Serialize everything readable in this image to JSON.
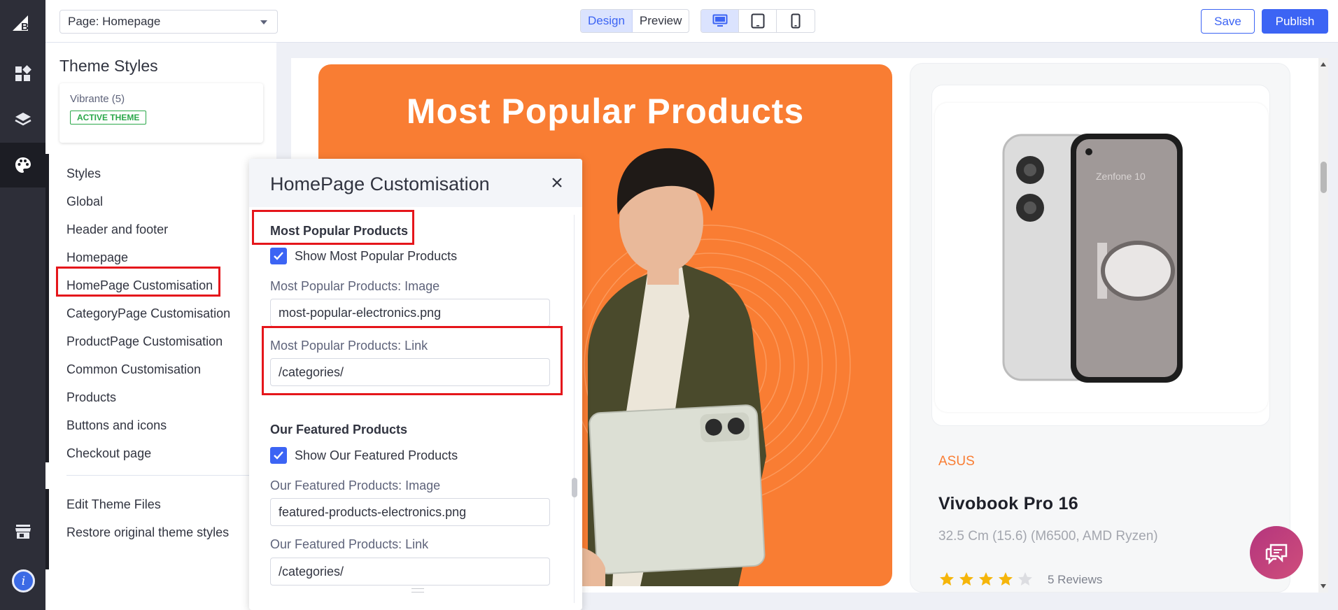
{
  "topbar": {
    "page_select": "Page: Homepage",
    "modes": [
      "Design",
      "Preview"
    ],
    "save_label": "Save",
    "publish_label": "Publish"
  },
  "sidebar": {
    "title": "Theme Styles",
    "theme_name": "Vibrante (5)",
    "theme_badge": "ACTIVE THEME",
    "items": [
      {
        "label": "Styles"
      },
      {
        "label": "Global"
      },
      {
        "label": "Header and footer"
      },
      {
        "label": "Homepage"
      },
      {
        "label": "HomePage Customisation"
      },
      {
        "label": "CategoryPage Customisation"
      },
      {
        "label": "ProductPage Customisation"
      },
      {
        "label": "Common Customisation"
      },
      {
        "label": "Products"
      },
      {
        "label": "Buttons and icons"
      },
      {
        "label": "Checkout page"
      }
    ],
    "footer_items": [
      {
        "label": "Edit Theme Files"
      },
      {
        "label": "Restore original theme styles"
      }
    ]
  },
  "modal": {
    "title": "HomePage Customisation",
    "sections": [
      {
        "title": "Most Popular Products",
        "checkbox_label": "Show Most Popular Products",
        "image_label": "Most Popular Products: Image",
        "image_value": "most-popular-electronics.png",
        "link_label": "Most Popular Products: Link",
        "link_value": "/categories/"
      },
      {
        "title": "Our Featured Products",
        "checkbox_label": "Show Our Featured Products",
        "image_label": "Our Featured Products: Image",
        "image_value": "featured-products-electronics.png",
        "link_label": "Our Featured Products: Link",
        "link_value": "/categories/"
      }
    ]
  },
  "preview": {
    "hero_title": "Most Popular Products",
    "product": {
      "brand": "ASUS",
      "name": "Vivobook Pro 16",
      "description": "32.5 Cm (15.6) (M6500, AMD Ryzen)",
      "rating_stars": 4,
      "rating_max": 5,
      "reviews": "5 Reviews"
    }
  },
  "colors": {
    "accent": "#3c64f4",
    "hero_orange": "#f97d33",
    "highlight_red": "#e5161b",
    "rail": "#2d2e38"
  }
}
